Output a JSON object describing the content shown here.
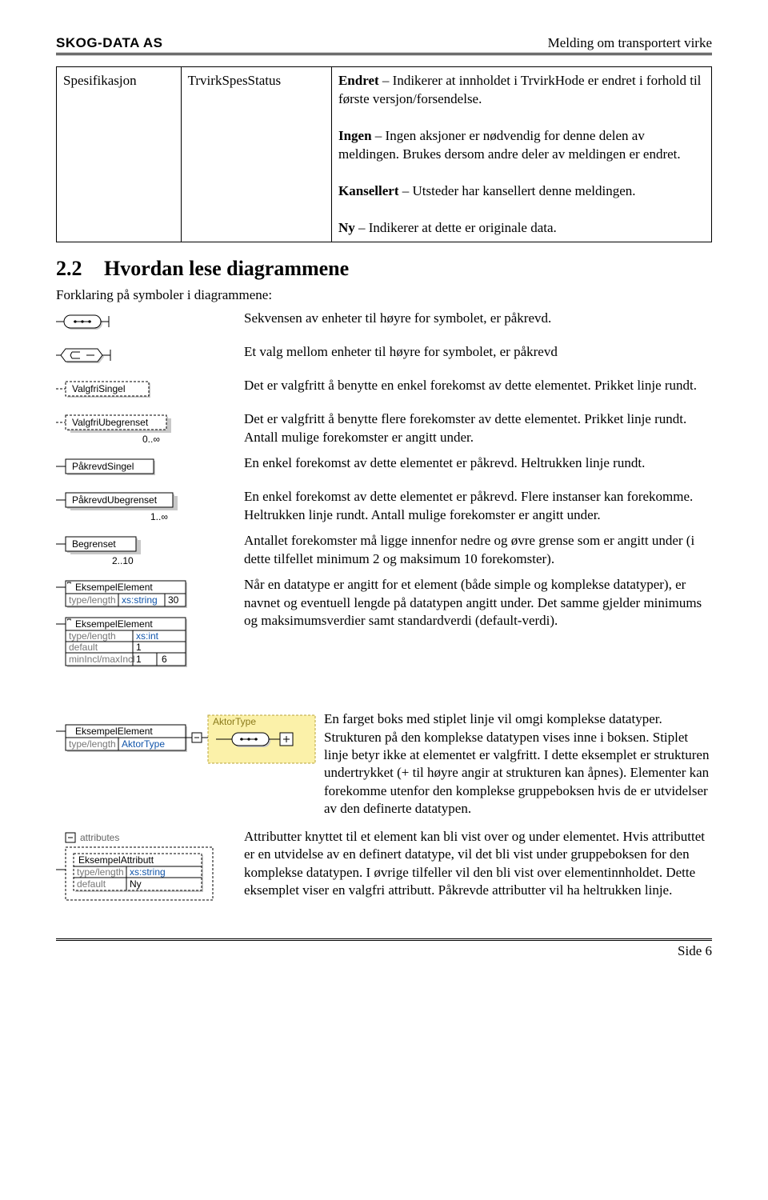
{
  "header": {
    "company": "SKOG-DATA AS",
    "doc_title": "Melding om transportert virke"
  },
  "spec_table": {
    "c0": "Spesifikasjon",
    "c1": "TrvirkSpesStatus",
    "c2_parts": {
      "endret_b": "Endret",
      "endret_txt": " – Indikerer at innholdet i TrvirkHode er endret i forhold til første versjon/forsendelse.",
      "ingen_b": "Ingen",
      "ingen_txt": " – Ingen aksjoner er nødvendig for denne delen av meldingen. Brukes dersom andre deler av meldingen er endret.",
      "kans_b": "Kansellert",
      "kans_txt": " – Utsteder har kansellert denne meldingen.",
      "ny_b": "Ny",
      "ny_txt": " – Indikerer at dette er originale data."
    }
  },
  "section": {
    "num": "2.2",
    "title": "Hvordan lese diagrammene",
    "intro": "Forklaring på symboler i diagrammene:"
  },
  "labels": {
    "valgfri_singel": "ValgfriSingel",
    "valgfri_ubegrenset": "ValgfriUbegrenset",
    "zero_inf": "0..∞",
    "pakrevd_singel": "PåkrevdSingel",
    "pakrevd_ubegrenset": "PåkrevdUbegrenset",
    "one_inf": "1..∞",
    "begrenset": "Begrenset",
    "two_ten": "2..10",
    "eksempel_element": "EksempelElement",
    "typelength": "type/length",
    "xs_string": "xs:string",
    "thirty": "30",
    "xs_int": "xs:int",
    "default": "default",
    "one": "1",
    "minmax": "minIncl/maxIncl",
    "six": "6",
    "aktortype": "AktorType",
    "attributes": "attributes",
    "eksempel_attributt": "EksempelAttributt",
    "ny_val": "Ny"
  },
  "legend": {
    "seq": "Sekvensen av enheter til høyre for symbolet, er påkrevd.",
    "choice": "Et valg mellom enheter til høyre for symbolet, er påkrevd",
    "opt_single": "Det er valgfritt å benytte en enkel forekomst av dette elementet. Prikket linje rundt.",
    "opt_unbounded": "Det er valgfritt å benytte flere forekomster av dette elementet. Prikket linje rundt. Antall mulige forekomster er angitt under.",
    "req_single": "En enkel forekomst av dette elementet er påkrevd. Heltrukken linje rundt.",
    "req_unbounded": "En enkel forekomst av dette elementet er påkrevd. Flere instanser kan forekomme. Heltrukken linje rundt. Antall mulige forekomster er angitt under.",
    "bounded": "Antallet forekomster må ligge innenfor nedre og øvre grense som er angitt under (i dette tilfellet minimum 2 og maksimum 10 forekomster).",
    "datatype": "Når en datatype er angitt for et element (både simple og komplekse datatyper), er navnet og eventuell lengde på datatypen angitt under. Det samme gjelder minimums og maksimumsverdier samt standardverdi (default-verdi).",
    "complex": "En farget boks med stiplet linje vil omgi komplekse datatyper. Strukturen på den komplekse datatypen vises inne i boksen. Stiplet linje betyr ikke at elementet er valgfritt. I dette eksemplet er strukturen undertrykket (+ til høyre angir at strukturen kan åpnes). Elementer kan forekomme utenfor den komplekse gruppeboksen hvis de er utvidelser av den definerte datatypen.",
    "attributes": "Attributter knyttet til et element kan bli vist over og under elementet. Hvis attributtet er en utvidelse av en definert datatype, vil det bli vist under gruppeboksen for den komplekse datatypen. I øvrige tilfeller vil den bli vist over elementinnholdet. Dette eksemplet viser en valgfri attributt. Påkrevde attributter vil ha heltrukken linje."
  },
  "footer": "Side 6"
}
